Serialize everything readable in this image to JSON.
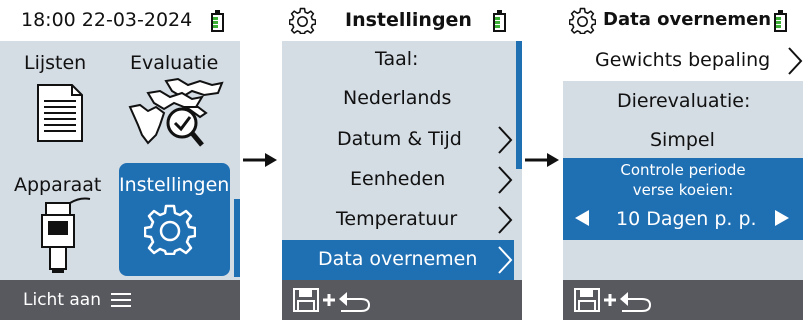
{
  "screen1": {
    "datetime": "18:00 22-03-2024",
    "tiles": [
      {
        "label": "Lijsten",
        "icon": "list-document-icon"
      },
      {
        "label": "Evaluatie",
        "icon": "cows-evaluation-icon"
      },
      {
        "label": "Apparaat",
        "icon": "device-probe-icon"
      },
      {
        "label": "Instellingen",
        "icon": "gear-icon"
      }
    ],
    "footer_label": "Licht aan",
    "footer_icon": "menu-icon"
  },
  "screen2": {
    "title": "Instellingen",
    "title_icon": "gear-icon",
    "items": [
      {
        "label": "Taal:"
      },
      {
        "label": "Nederlands"
      },
      {
        "label": "Datum & Tijd"
      },
      {
        "label": "Eenheden"
      },
      {
        "label": "Temperatuur"
      },
      {
        "label": "Data overnemen"
      }
    ],
    "footer_icons": [
      "save-icon",
      "plus-icon",
      "return-icon"
    ]
  },
  "screen3": {
    "title": "Data overnemen",
    "title_icon": "gear-icon",
    "weight_label": "Gewichts bepaling",
    "evaluation_label": "Dierevaluatie:",
    "evaluation_value": "Simpel",
    "period_label": "Controle periode verse koeien:",
    "period_value": "10 Dagen p. p.",
    "footer_icons": [
      "save-icon",
      "plus-icon",
      "return-icon"
    ]
  },
  "colors": {
    "accent": "#1f6fb3",
    "panel": "#d4dce4",
    "footer": "#58595f",
    "battery": "#3cb035"
  }
}
